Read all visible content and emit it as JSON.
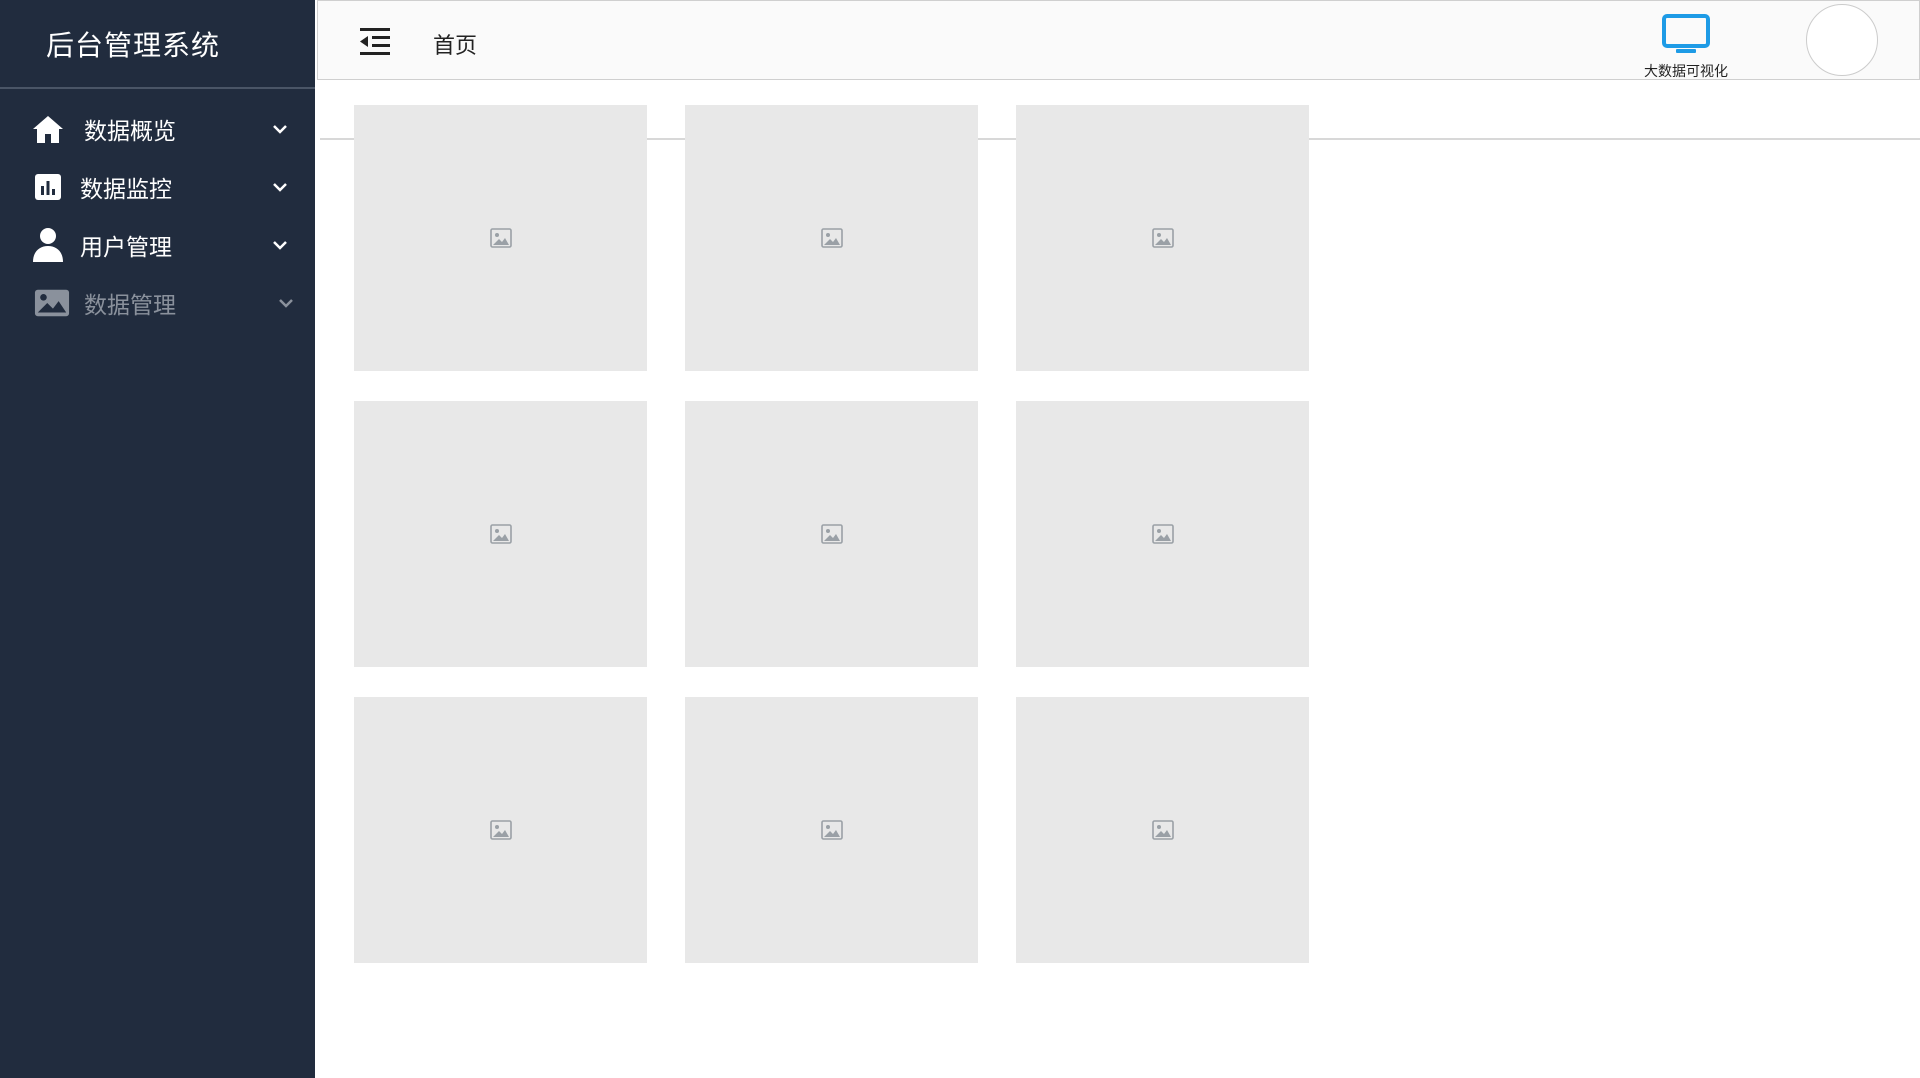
{
  "app": {
    "title": "后台管理系统"
  },
  "sidebar": {
    "items": [
      {
        "label": "数据概览",
        "icon": "home-icon",
        "dim": false
      },
      {
        "label": "数据监控",
        "icon": "bar-chart-icon",
        "dim": false
      },
      {
        "label": "用户管理",
        "icon": "user-icon",
        "dim": false
      },
      {
        "label": "数据管理",
        "icon": "image-icon",
        "dim": true
      }
    ]
  },
  "header": {
    "breadcrumb": "首页",
    "bigdata_label": "大数据可视化",
    "bigdata_icon": "monitor-icon",
    "accent_color": "#1e9be6"
  },
  "main": {
    "tiles": [
      {
        "icon": "image-placeholder-icon"
      },
      {
        "icon": "image-placeholder-icon"
      },
      {
        "icon": "image-placeholder-icon"
      },
      {
        "icon": "image-placeholder-icon"
      },
      {
        "icon": "image-placeholder-icon"
      },
      {
        "icon": "image-placeholder-icon"
      },
      {
        "icon": "image-placeholder-icon"
      },
      {
        "icon": "image-placeholder-icon"
      },
      {
        "icon": "image-placeholder-icon"
      }
    ]
  },
  "colors": {
    "sidebar_bg": "#212c3e",
    "tile_bg": "#e8e8e8"
  }
}
